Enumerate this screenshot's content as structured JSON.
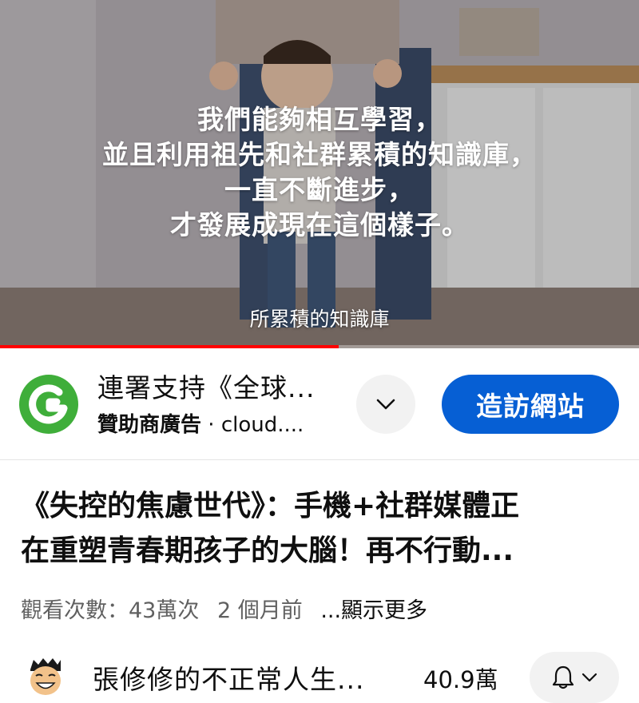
{
  "video": {
    "caption_lines": [
      "我們能夠相互學習，",
      "並且利用祖先和社群累積的知識庫，",
      "一直不斷進步，",
      "才發展成現在這個樣子。"
    ],
    "subtitle": "所累積的知識庫",
    "progress": 0.53,
    "progress_color": "#ff0000"
  },
  "ad": {
    "logo_icon": "green-g-logo-icon",
    "title": "連署支持《全球...",
    "sponsor_label": "贊助商廣告",
    "separator": " · ",
    "domain": "cloud....",
    "expand_icon": "chevron-down-icon",
    "visit_label": "造訪網站",
    "accent_color": "#065fd4"
  },
  "title": {
    "lines": [
      "《失控的焦慮世代》：手機+社群媒體正",
      "在重塑青春期孩子的大腦！再不行動..."
    ]
  },
  "meta": {
    "views": "觀看次數：43萬次",
    "age": "2 個月前",
    "more": "...顯示更多"
  },
  "channel": {
    "avatar_icon": "cartoon-face-avatar-icon",
    "name": "張修修的不正常人生...",
    "subscribers": "40.9萬",
    "bell_icon": "bell-icon",
    "dropdown_icon": "chevron-down-icon"
  }
}
